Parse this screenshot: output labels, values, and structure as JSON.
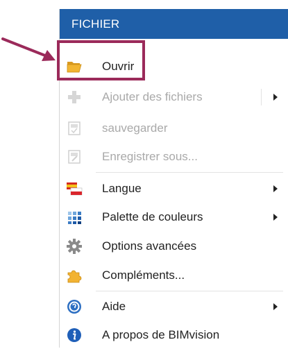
{
  "menu": {
    "title": "FICHIER",
    "items": [
      {
        "label": "Ouvrir",
        "icon": "folder-open-icon"
      },
      {
        "label": "Ajouter des fichiers",
        "icon": "add-files-icon"
      },
      {
        "label": "sauvegarder",
        "icon": "save-icon"
      },
      {
        "label": "Enregistrer sous...",
        "icon": "save-as-icon"
      },
      {
        "label": "Langue",
        "icon": "language-flag-icon"
      },
      {
        "label": "Palette de couleurs",
        "icon": "color-palette-icon"
      },
      {
        "label": "Options avancées",
        "icon": "gear-icon"
      },
      {
        "label": "Compléments...",
        "icon": "puzzle-icon"
      },
      {
        "label": "Aide",
        "icon": "help-icon"
      },
      {
        "label": "A propos de BIMvision",
        "icon": "info-icon"
      }
    ]
  },
  "colors": {
    "header_bg": "#1f5fa8",
    "highlight": "#9b2a5a",
    "disabled_text": "#a9a9a9"
  }
}
